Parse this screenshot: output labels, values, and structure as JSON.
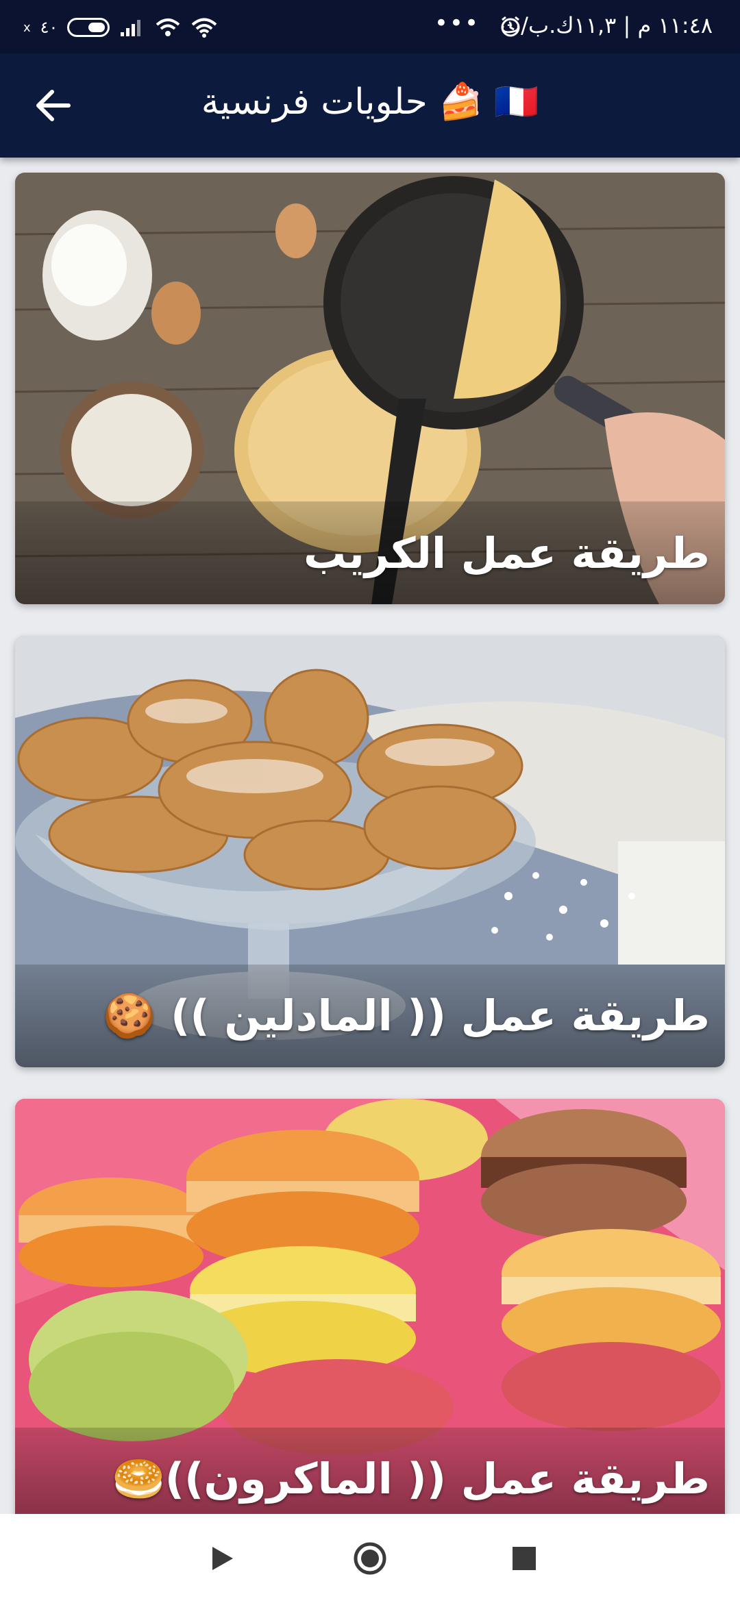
{
  "status_bar": {
    "time": "١١:٤٨ م | ١١,٣ك.ب/ث",
    "dots": "•••",
    "battery": "٤٠",
    "small_indicator": "x",
    "icons": [
      "alarm-icon",
      "wifi-icon",
      "wifi-icon",
      "signal-icon",
      "battery-icon"
    ]
  },
  "app_bar": {
    "title": "🇫🇷 🍰 حلويات فرنسية",
    "back_icon": "arrow-left-icon"
  },
  "cards": [
    {
      "caption": "طريقة عمل الكريب"
    },
    {
      "caption": "طريقة عمل (( المادلين )) 🍪"
    },
    {
      "caption": "طريقة عمل (( الماكرون))🥯"
    }
  ],
  "nav_bar": {
    "icons": [
      "back-triangle-icon",
      "home-circle-icon",
      "recents-square-icon"
    ]
  },
  "colors": {
    "status_bar": "#0b1330",
    "app_bar": "#0b1a3d",
    "background": "#e9ebef"
  }
}
